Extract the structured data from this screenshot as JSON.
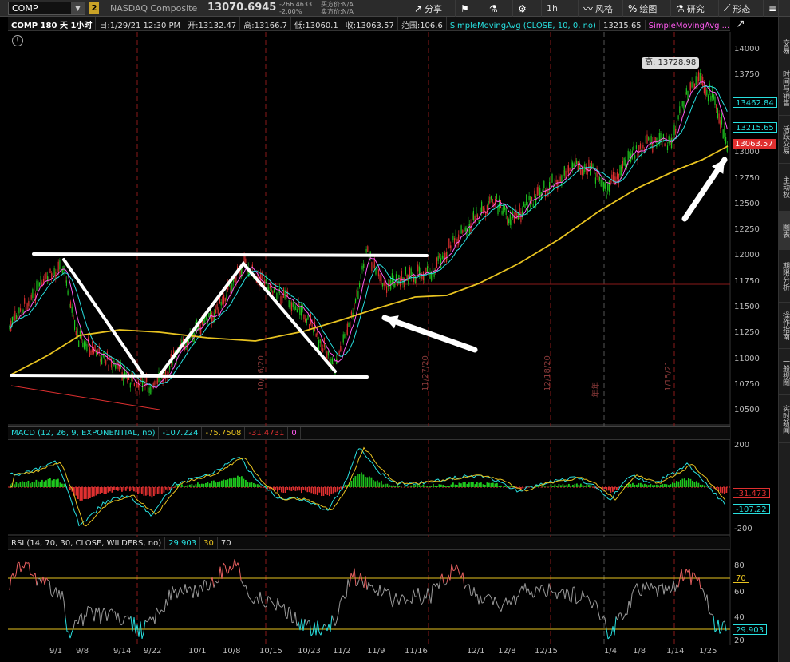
{
  "toolbar": {
    "symbol": "COMP",
    "link_badge": "2",
    "name": "NASDAQ Composite",
    "price": "13070.6945",
    "change": "-266.4633",
    "change_pct": "-2.00%",
    "bid": "买方价:N/A",
    "ask": "卖方价:N/A",
    "share": "分享",
    "interval": "1h",
    "style": "风格",
    "drawings": "绘图",
    "studies": "研究",
    "patterns": "形态"
  },
  "header": {
    "title": "COMP 180 天 1小时",
    "date": "日:1/29/21 12:30 PM",
    "open": "开:13132.47",
    "high": "高:13166.7",
    "low": "低:13060.1",
    "close": "收:13063.57",
    "range": "范围:106.6",
    "sma1_name": "SimpleMovingAvg (CLOSE, 10, 0, no)",
    "sma1_val": "13215.65",
    "sma2_name": "SimpleMovingAvg ..."
  },
  "price_axis": {
    "labels": [
      "14000",
      "13750",
      "13500",
      "13250",
      "13000",
      "12750",
      "12500",
      "12250",
      "12000",
      "11750",
      "11500",
      "11250",
      "11000",
      "10750",
      "10500"
    ],
    "tags": {
      "sma_slow": "13462.84",
      "sma_fast": "13215.65",
      "last": "13063.57"
    },
    "high_label": "高: 13728.98"
  },
  "macd": {
    "header": [
      "MACD (12, 26, 9, EXPONENTIAL, no)",
      "-107.224",
      "-75.7508",
      "-31.4731",
      "0"
    ],
    "axis": [
      "200",
      "-200"
    ],
    "tags": [
      "-31.473",
      "-107.22"
    ]
  },
  "rsi": {
    "header": [
      "RSI (14, 70, 30, CLOSE, WILDERS, no)",
      "29.903",
      "30",
      "70"
    ],
    "axis": [
      "80",
      "60",
      "40",
      "20"
    ],
    "tags": [
      "70",
      "29.903"
    ]
  },
  "x_axis": [
    "9/1",
    "9/8",
    "9/14",
    "9/22",
    "10/1",
    "10/8",
    "10/15",
    "10/23",
    "11/2",
    "11/9",
    "11/16",
    "12/1",
    "12/8",
    "12/15",
    "1/4",
    "1/8",
    "1/14",
    "1/25"
  ],
  "vertical_markers": [
    "10/16/20",
    "11/27/20",
    "12/18/20",
    "年年",
    "1/15/21"
  ],
  "right_tabs": [
    "交易",
    "时间与销售",
    "活跃交易",
    "主动权",
    "图表",
    "期限分析",
    "操作指南",
    "一般视图",
    "实时新闻"
  ],
  "colors": {
    "up": "#1ec81e",
    "down": "#e03030",
    "sma_fast": "#28e0e0",
    "sma_mid": "#ff5af0",
    "sma_slow_yellow": "#e8c320",
    "accent": "#28e0e0"
  }
}
